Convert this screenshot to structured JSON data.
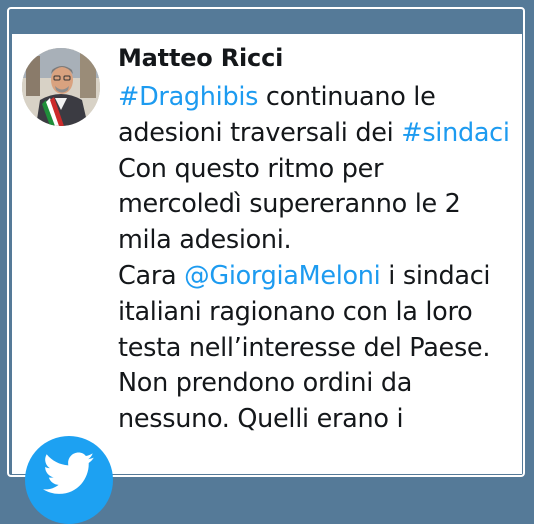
{
  "tweet": {
    "author": "Matteo Ricci",
    "lines": [
      [
        {
          "text": "#Draghibis",
          "link": true
        },
        {
          "text": " continuano le",
          "link": false
        }
      ],
      [
        {
          "text": "adesioni traversali dei ",
          "link": false
        },
        {
          "text": "#sindaci",
          "link": true
        }
      ],
      [
        {
          "text": "Con questo ritmo per",
          "link": false
        }
      ],
      [
        {
          "text": "mercoledì supereranno le 2",
          "link": false
        }
      ],
      [
        {
          "text": "mila adesioni.",
          "link": false
        }
      ],
      [
        {
          "text": "Cara ",
          "link": false
        },
        {
          "text": "@GiorgiaMeloni",
          "link": true
        },
        {
          "text": " i sindaci",
          "link": false
        }
      ],
      [
        {
          "text": "italiani ragionano con la loro",
          "link": false
        }
      ],
      [
        {
          "text": "testa nell’interesse del Paese.",
          "link": false
        }
      ],
      [
        {
          "text": "Non prendono ordini da",
          "link": false
        }
      ],
      [
        {
          "text": "nessuno. Quelli erano i",
          "link": false
        }
      ]
    ]
  },
  "colors": {
    "background": "#557a98",
    "card": "#ffffff",
    "text": "#14171a",
    "link": "#1d9bf0",
    "twitter_blue": "#1da1f2"
  },
  "icons": {
    "badge": "twitter-bird-icon",
    "avatar": "profile-photo"
  }
}
